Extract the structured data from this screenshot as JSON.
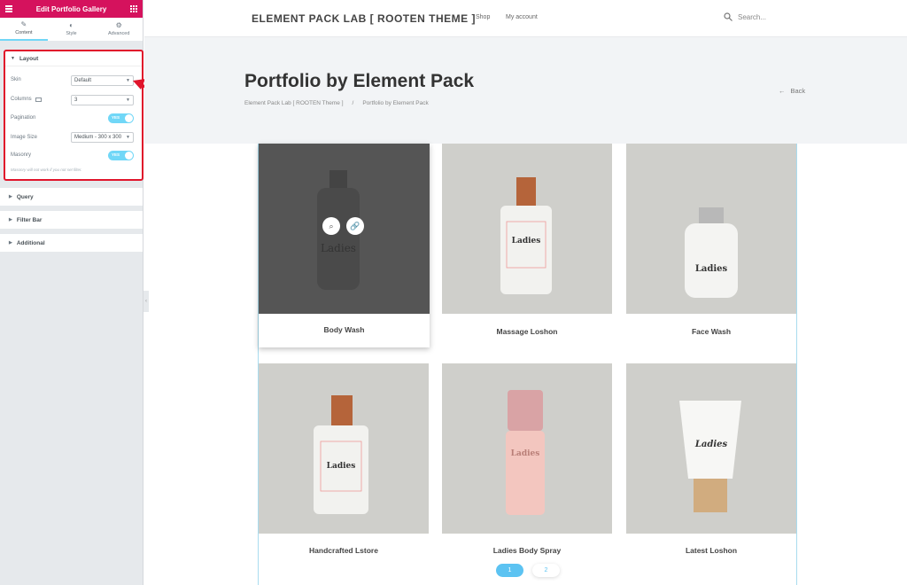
{
  "panel": {
    "title": "Edit Portfolio Gallery",
    "tabs": [
      {
        "label": "Content",
        "icon": "pencil-icon"
      },
      {
        "label": "Style",
        "icon": "contrast-icon"
      },
      {
        "label": "Advanced",
        "icon": "gear-icon"
      }
    ],
    "layout": {
      "heading": "Layout",
      "skin": {
        "label": "Skin",
        "value": "Default"
      },
      "columns": {
        "label": "Columns",
        "value": "3"
      },
      "pagination": {
        "label": "Pagination",
        "toggle": "YES"
      },
      "image_size": {
        "label": "Image Size",
        "value": "Medium - 300 x 300"
      },
      "masonry": {
        "label": "Masonry",
        "toggle": "YES"
      },
      "note": "Masonry will not work if you not set filter."
    },
    "sections": [
      "Query",
      "Filter Bar",
      "Additional"
    ]
  },
  "site": {
    "brand": "ELEMENT PACK LAB [ ROOTEN THEME ]",
    "nav": [
      "Shop",
      "My account"
    ],
    "search_placeholder": "Search..."
  },
  "hero": {
    "title": "Portfolio by Element Pack",
    "crumbs": [
      "Element Pack Lab [ ROOTEN Theme ]",
      "/",
      "Portfolio by Element Pack"
    ],
    "back": "Back"
  },
  "gallery": {
    "items": [
      {
        "name": "Body Wash",
        "label": "Ladies"
      },
      {
        "name": "Massage Loshon",
        "label": "Ladies"
      },
      {
        "name": "Face Wash",
        "label": "Ladies"
      },
      {
        "name": "Handcrafted Lstore",
        "label": "Ladies"
      },
      {
        "name": "Ladies Body Spray",
        "label": "Ladies"
      },
      {
        "name": "Latest Loshon",
        "label": "Ladies"
      }
    ],
    "pages": [
      "1",
      "2"
    ]
  },
  "colors": {
    "accent": "#d5125d",
    "toggle": "#71d7f7",
    "highlight": "#e0142b"
  }
}
